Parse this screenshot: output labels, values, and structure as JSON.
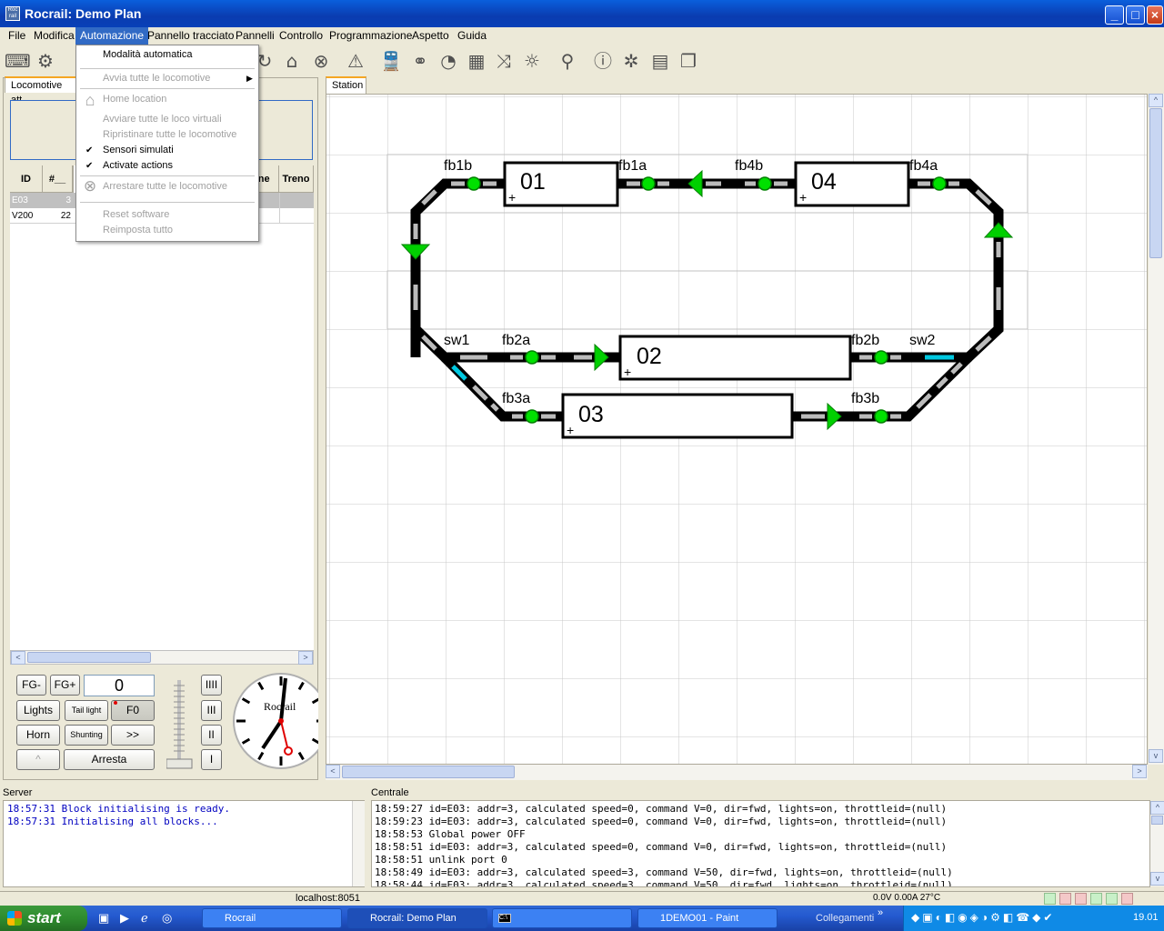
{
  "window": {
    "title": "Rocrail: Demo Plan",
    "app_icon_text": "Roc rail",
    "min": "_",
    "max": "□",
    "close": "×"
  },
  "menubar": [
    "File",
    "Modifica",
    "Automazione",
    "Pannello tracciato",
    "Pannelli",
    "Controllo",
    "Programmazione",
    "Aspetto",
    "Guida"
  ],
  "automazione_menu": {
    "items": [
      {
        "label": "Modalità automatica",
        "enabled": true
      },
      {
        "label": "Avvia tutte le locomotive",
        "enabled": false,
        "submenu": true
      },
      {
        "label": "Home location",
        "enabled": false,
        "icon": "home-icon"
      },
      {
        "label": "Avviare tutte le loco virtuali",
        "enabled": false
      },
      {
        "label": "Ripristinare tutte le locomotive",
        "enabled": false
      },
      {
        "label": "Sensori simulati",
        "enabled": true,
        "checked": true
      },
      {
        "label": "Activate actions",
        "enabled": true,
        "checked": true
      },
      {
        "label": "Arrestare tutte le locomotive",
        "enabled": false,
        "icon": "stop-circle-icon"
      },
      {
        "label": "Reset software",
        "enabled": false
      },
      {
        "label": "Reimposta tutto",
        "enabled": false
      }
    ]
  },
  "left_panel": {
    "tab": "Locomotive att",
    "table": {
      "headers": [
        "ID",
        "#__",
        "one",
        "Treno"
      ],
      "rows": [
        {
          "id": "E03",
          "num": "3",
          "selected": true
        },
        {
          "id": "V200",
          "num": "22",
          "selected": false
        }
      ]
    }
  },
  "throttle": {
    "fg_minus": "FG-",
    "fg_plus": "FG+",
    "speed": "0",
    "lights": "Lights",
    "tail_light": "Tail light",
    "f0": "F0",
    "horn": "Horn",
    "shunting": "Shunting",
    "more": ">>",
    "caret": "^",
    "stop": "Arresta",
    "steps": [
      "IIII",
      "III",
      "II",
      "I"
    ],
    "clock_brand": "Rocrail"
  },
  "plan": {
    "tab": "Station",
    "blocks": [
      "01",
      "04",
      "02",
      "03"
    ],
    "labels": {
      "fb1b": "fb1b",
      "fb1a": "fb1a",
      "fb4b": "fb4b",
      "fb4a": "fb4a",
      "sw1": "sw1",
      "fb2a": "fb2a",
      "fb2b": "fb2b",
      "sw2": "sw2",
      "fb3a": "fb3a",
      "fb3b": "fb3b"
    }
  },
  "server": {
    "label": "Server",
    "lines": [
      "18:57:31 Block initialising is ready.",
      "18:57:31 Initialising all blocks..."
    ]
  },
  "centrale": {
    "label": "Centrale",
    "lines": [
      "18:59:27 id=E03: addr=3, calculated speed=0, command V=0, dir=fwd, lights=on, throttleid=(null)",
      "18:59:23 id=E03: addr=3, calculated speed=0, command V=0, dir=fwd, lights=on, throttleid=(null)",
      "18:58:53 Global power OFF",
      "18:58:51 id=E03: addr=3, calculated speed=0, command V=0, dir=fwd, lights=on, throttleid=(null)",
      "18:58:51 unlink port 0",
      "18:58:49 id=E03: addr=3, calculated speed=3, command V=50, dir=fwd, lights=on, throttleid=(null)",
      "18:58:44 id=E03: addr=3, calculated speed=3, command V=50, dir=fwd, lights=on, throttleid=(null)"
    ]
  },
  "statusbar": {
    "host": "localhost:8051",
    "power": "0.0V 0.00A 27°C"
  },
  "taskbar": {
    "start": "start",
    "tasks": [
      "Rocrail",
      "Rocrail: Demo Plan",
      "",
      "1DEMO01 - Paint"
    ],
    "links": "Collegamenti",
    "time": "19.01"
  }
}
